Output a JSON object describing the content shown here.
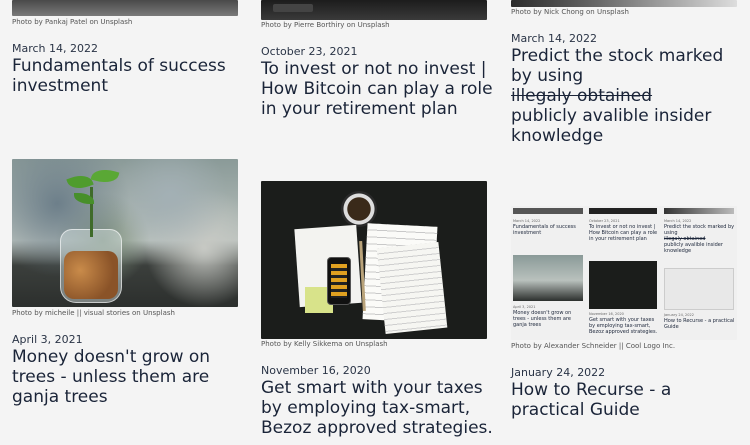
{
  "cards": [
    {
      "credit": "Photo by Pankaj Patel on Unsplash",
      "date": "March 14, 2022",
      "title": "Fundamentals of success investment"
    },
    {
      "credit": "Photo by Pierre Borthiry on Unsplash",
      "date": "October 23, 2021",
      "title": "To invest or not no invest | How Bitcoin can play a role in your retirement plan"
    },
    {
      "credit": "Photo by Nick Chong on Unsplash",
      "date": "March 14, 2022",
      "title_part1": "Predict the stock marked by using",
      "title_strike": "illegaly obtained",
      "title_part2": "publicly avalible insider knowledge"
    },
    {
      "credit": "Photo by micheile || visual stories on Unsplash",
      "date": "April 3, 2021",
      "title": "Money doesn't grow on trees - unless them are ganja trees"
    },
    {
      "credit": "Photo by Kelly Sikkema on Unsplash",
      "date": "November 16, 2020",
      "title": "Get smart with your taxes by employing tax-smart, Bezoz approved strategies."
    },
    {
      "credit": "Photo by Alexander Schneider || Cool Logo Inc.",
      "date": "January 24, 2022",
      "title": "How to Recurse - a practical Guide"
    }
  ],
  "collage": {
    "items": [
      {
        "date": "March 14, 2022",
        "title": "Fundamentals of success investment"
      },
      {
        "date": "October 23, 2021",
        "title": "To invest or not no invest | How Bitcoin can play a role in your retirement plan"
      },
      {
        "date": "March 14, 2022",
        "title_part1": "Predict the stock marked by using",
        "title_strike": "illegaly obtained",
        "title_part2": "publicly avalible insider knowledge"
      },
      {
        "date": "April 3, 2021",
        "title": "Money doesn't grow on trees - unless them are ganja trees"
      },
      {
        "date": "November 16, 2020",
        "title": "Get smart with your taxes by employing tax-smart, Bezoz approved strategies."
      },
      {
        "date": "January 24, 2022",
        "title": "How to Recurse - a practical Guide"
      }
    ]
  }
}
